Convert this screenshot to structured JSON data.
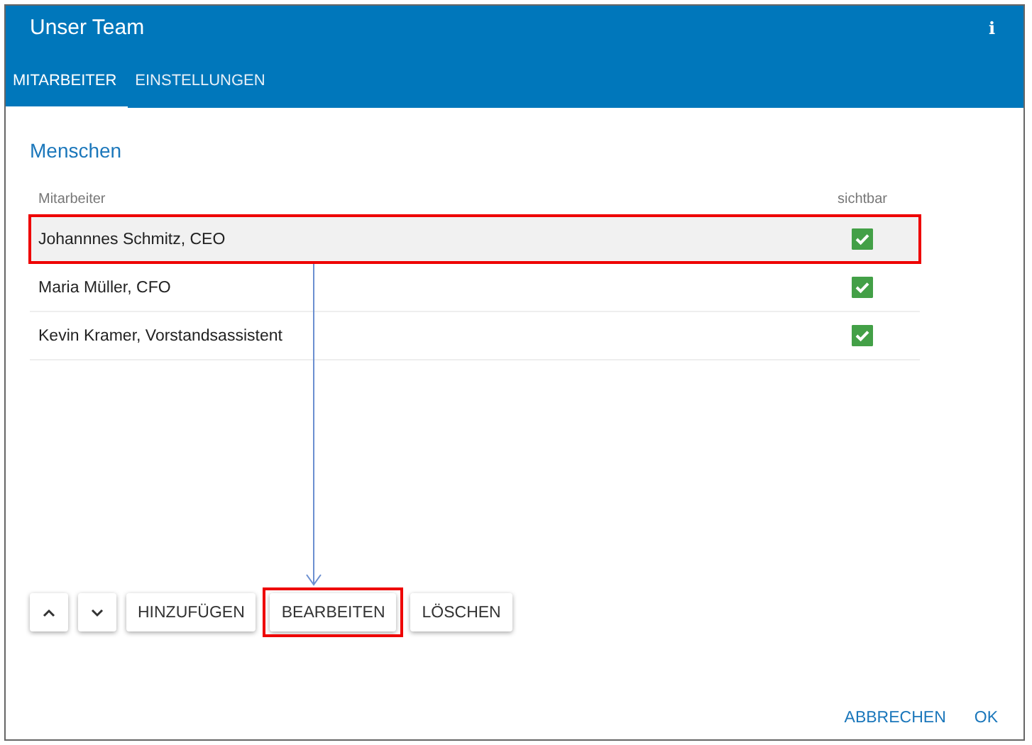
{
  "window": {
    "title": "Unser Team",
    "info_icon": "i"
  },
  "tabs": [
    {
      "label": "MITARBEITER",
      "selected": true
    },
    {
      "label": "EINSTELLUNGEN",
      "selected": false
    }
  ],
  "section_title": "Menschen",
  "table": {
    "columns": [
      "Mitarbeiter",
      "sichtbar"
    ],
    "rows": [
      {
        "name": "Johannnes Schmitz, CEO",
        "visible": true,
        "selected": true,
        "highlighted": true
      },
      {
        "name": "Maria Müller, CFO",
        "visible": true,
        "selected": false,
        "highlighted": false
      },
      {
        "name": "Kevin Kramer, Vorstandsassistent",
        "visible": true,
        "selected": false,
        "highlighted": false
      }
    ]
  },
  "toolbar": [
    {
      "kind": "up"
    },
    {
      "kind": "down"
    },
    {
      "kind": "text",
      "label": "HINZUFÜGEN",
      "highlighted": false
    },
    {
      "kind": "text",
      "label": "BEARBEITEN",
      "highlighted": true
    },
    {
      "kind": "text",
      "label": "LÖSCHEN",
      "highlighted": false
    }
  ],
  "annotation_arrow": true,
  "footer_buttons": [
    "ABBRECHEN",
    "OK"
  ]
}
